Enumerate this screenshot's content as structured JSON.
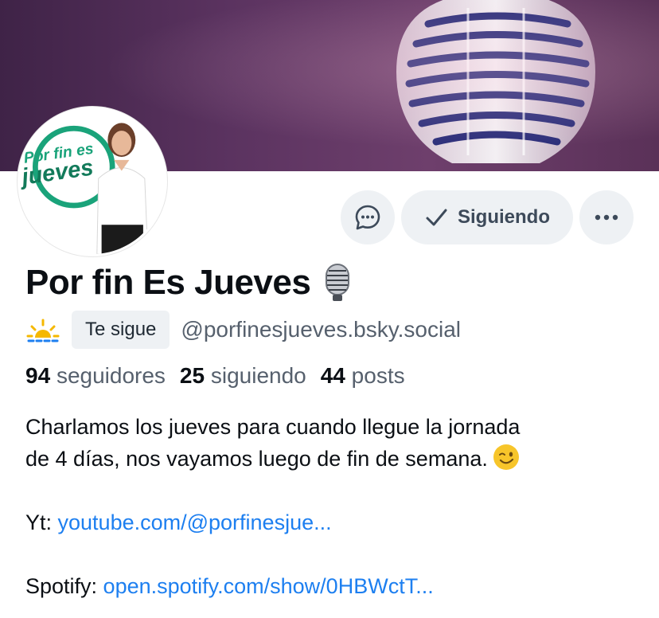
{
  "banner": {
    "icon": "microphone-icon"
  },
  "avatar": {
    "logo_line1": "Por fin es",
    "logo_line2": "jueves"
  },
  "actions": {
    "message_icon": "chat-bubble-icon",
    "follow_label": "Siguiendo",
    "follow_icon": "checkmark-icon",
    "more_icon": "ellipsis-icon"
  },
  "profile": {
    "display_name": "Por fin Es Jueves",
    "name_emoji": "studio-microphone-icon",
    "follows_you": "Te sigue",
    "handle": "@porfinesjueves.bsky.social"
  },
  "stats": {
    "followers_count": "94",
    "followers_label": "seguidores",
    "following_count": "25",
    "following_label": "siguiendo",
    "posts_count": "44",
    "posts_label": "posts"
  },
  "bio": {
    "line1": "Charlamos los jueves para cuando llegue la jornada",
    "line2": "de 4 días, nos vayamos luego de fin de semana.",
    "yt_label": "Yt: ",
    "yt_link": "youtube.com/@porfinesjue...",
    "spotify_label": "Spotify: ",
    "spotify_link": "open.spotify.com/show/0HBWctT..."
  },
  "colors": {
    "link": "#1d7ff0",
    "accent_green": "#1aa37a",
    "button_bg": "#eef1f4"
  }
}
